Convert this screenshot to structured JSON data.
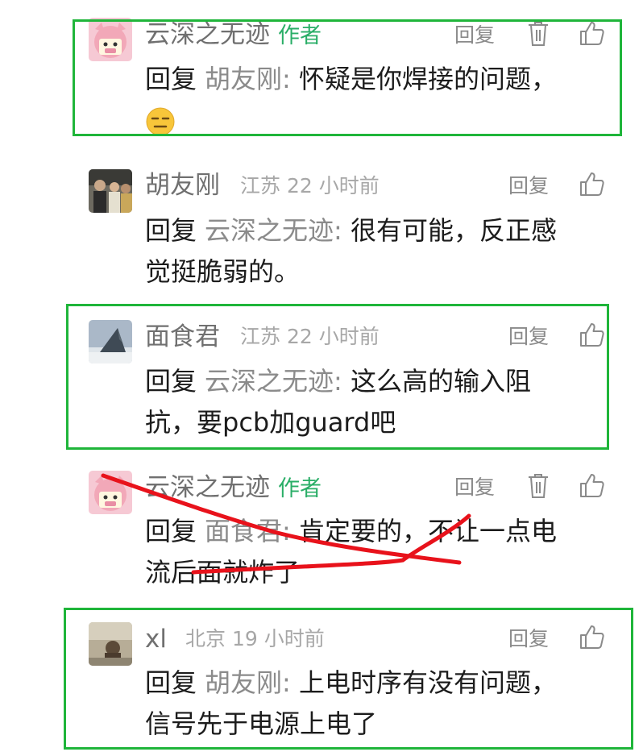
{
  "comments": [
    {
      "name": "云深之无迹",
      "tag": "作者",
      "location": "",
      "time": "",
      "reply_label": "回复",
      "reply_to": "胡友刚",
      "text": "怀疑是你焊接的问题，",
      "emoji": "expressionless-face",
      "has_delete": true
    },
    {
      "name": "胡友刚",
      "tag": "",
      "location": "江苏",
      "time": "22 小时前",
      "reply_label": "回复",
      "reply_to": "云深之无迹",
      "text_line1": "很有可能，反正感",
      "text_line2": "觉挺脆弱的。",
      "has_delete": false
    },
    {
      "name": "面食君",
      "tag": "",
      "location": "江苏",
      "time": "22 小时前",
      "reply_label": "回复",
      "reply_to": "云深之无迹",
      "text_line1": "这么高的输入阻",
      "text_line2": "抗，要pcb加guard吧",
      "has_delete": false
    },
    {
      "name": "云深之无迹",
      "tag": "作者",
      "location": "",
      "time": "",
      "reply_label": "回复",
      "reply_to": "面食君",
      "text_line1": "肯定要的，不让一点电",
      "text_line2": "流后面就炸了",
      "has_delete": true
    },
    {
      "name": "xl",
      "tag": "",
      "location": "北京",
      "time": "19 小时前",
      "reply_label": "回复",
      "reply_to": "胡友刚",
      "text_line1": "上电时序有没有问题，",
      "text_line2": "信号先于电源上电了",
      "has_delete": false
    }
  ],
  "reply_prefix": "回复",
  "colon": ":",
  "icons": [
    "trash-icon",
    "thumbs-up-icon"
  ],
  "colors": {
    "author_tag": "#2aae67",
    "highlight_box": "#1fb53a",
    "strike": "#e8121b"
  }
}
